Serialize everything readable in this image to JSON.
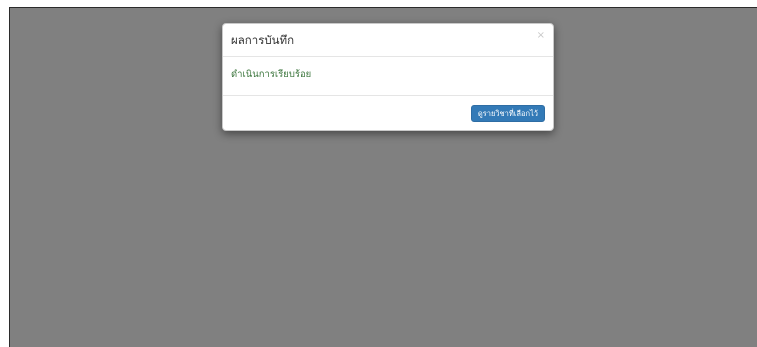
{
  "modal": {
    "title": "ผลการบันทึก",
    "close_label": "×",
    "message": "ดำเนินการเรียบร้อย",
    "primary_button_label": "ดูรายวิชาที่เลือกไว้"
  },
  "colors": {
    "backdrop": "#808080",
    "message_text": "#3c763d",
    "primary_button": "#337ab7"
  }
}
